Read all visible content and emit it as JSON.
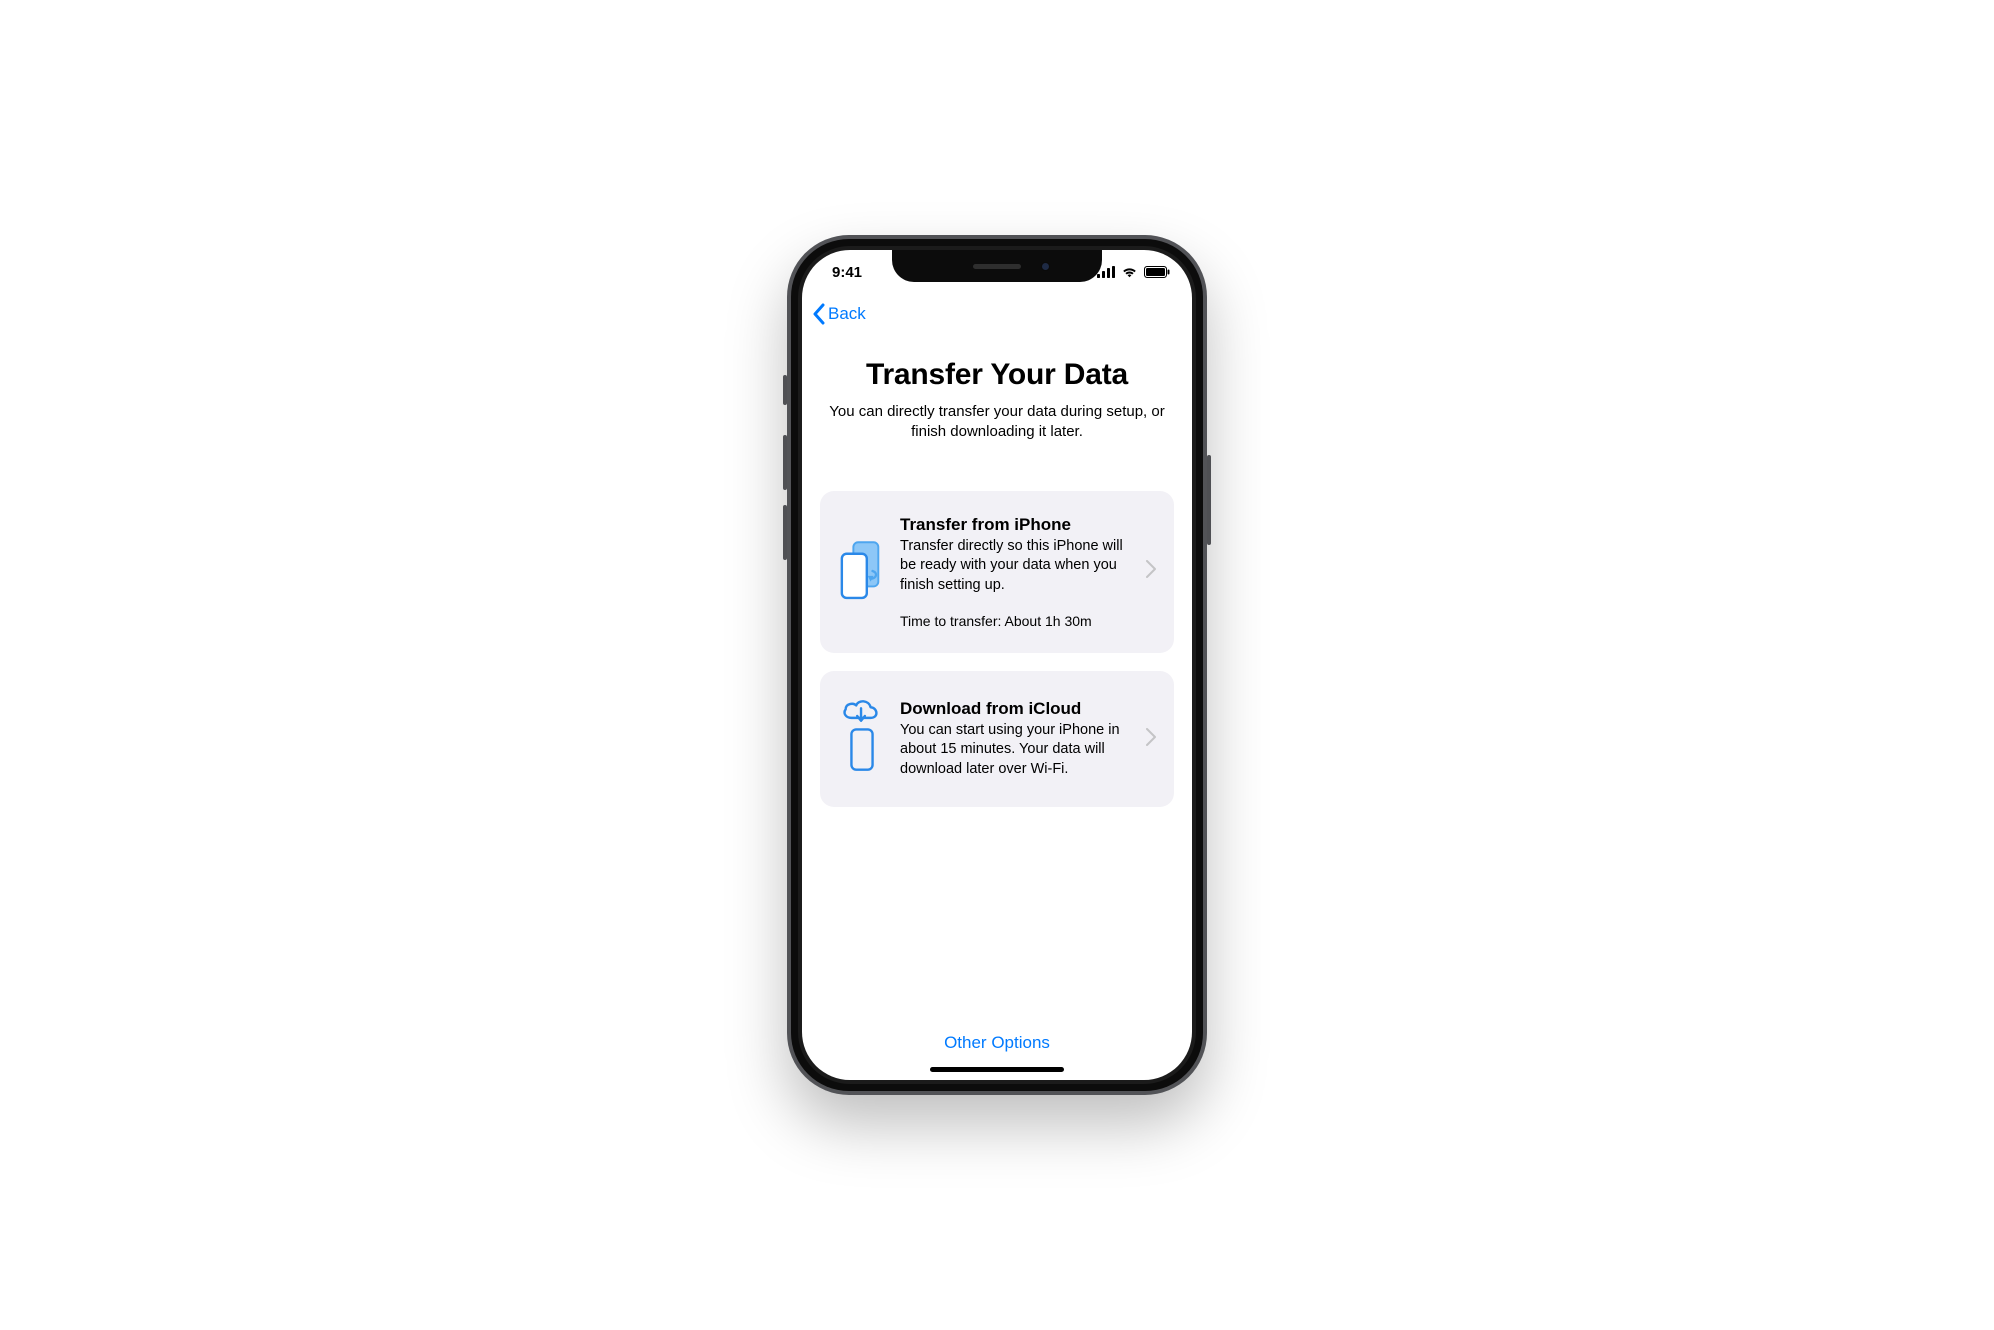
{
  "status_bar": {
    "time": "9:41"
  },
  "nav": {
    "back_label": "Back"
  },
  "header": {
    "title": "Transfer Your Data",
    "subtitle": "You can directly transfer your data during setup, or finish downloading it later."
  },
  "options": [
    {
      "title": "Transfer from iPhone",
      "desc": "Transfer directly so this iPhone will be ready with your data when you finish setting up.",
      "extra": "Time to transfer: About 1h 30m"
    },
    {
      "title": "Download from iCloud",
      "desc": "You can start using your iPhone in about 15 minutes. Your data will download later over Wi-Fi.",
      "extra": ""
    }
  ],
  "footer": {
    "other_options": "Other Options"
  },
  "colors": {
    "accent": "#007aff",
    "card_bg": "#f2f1f6"
  }
}
